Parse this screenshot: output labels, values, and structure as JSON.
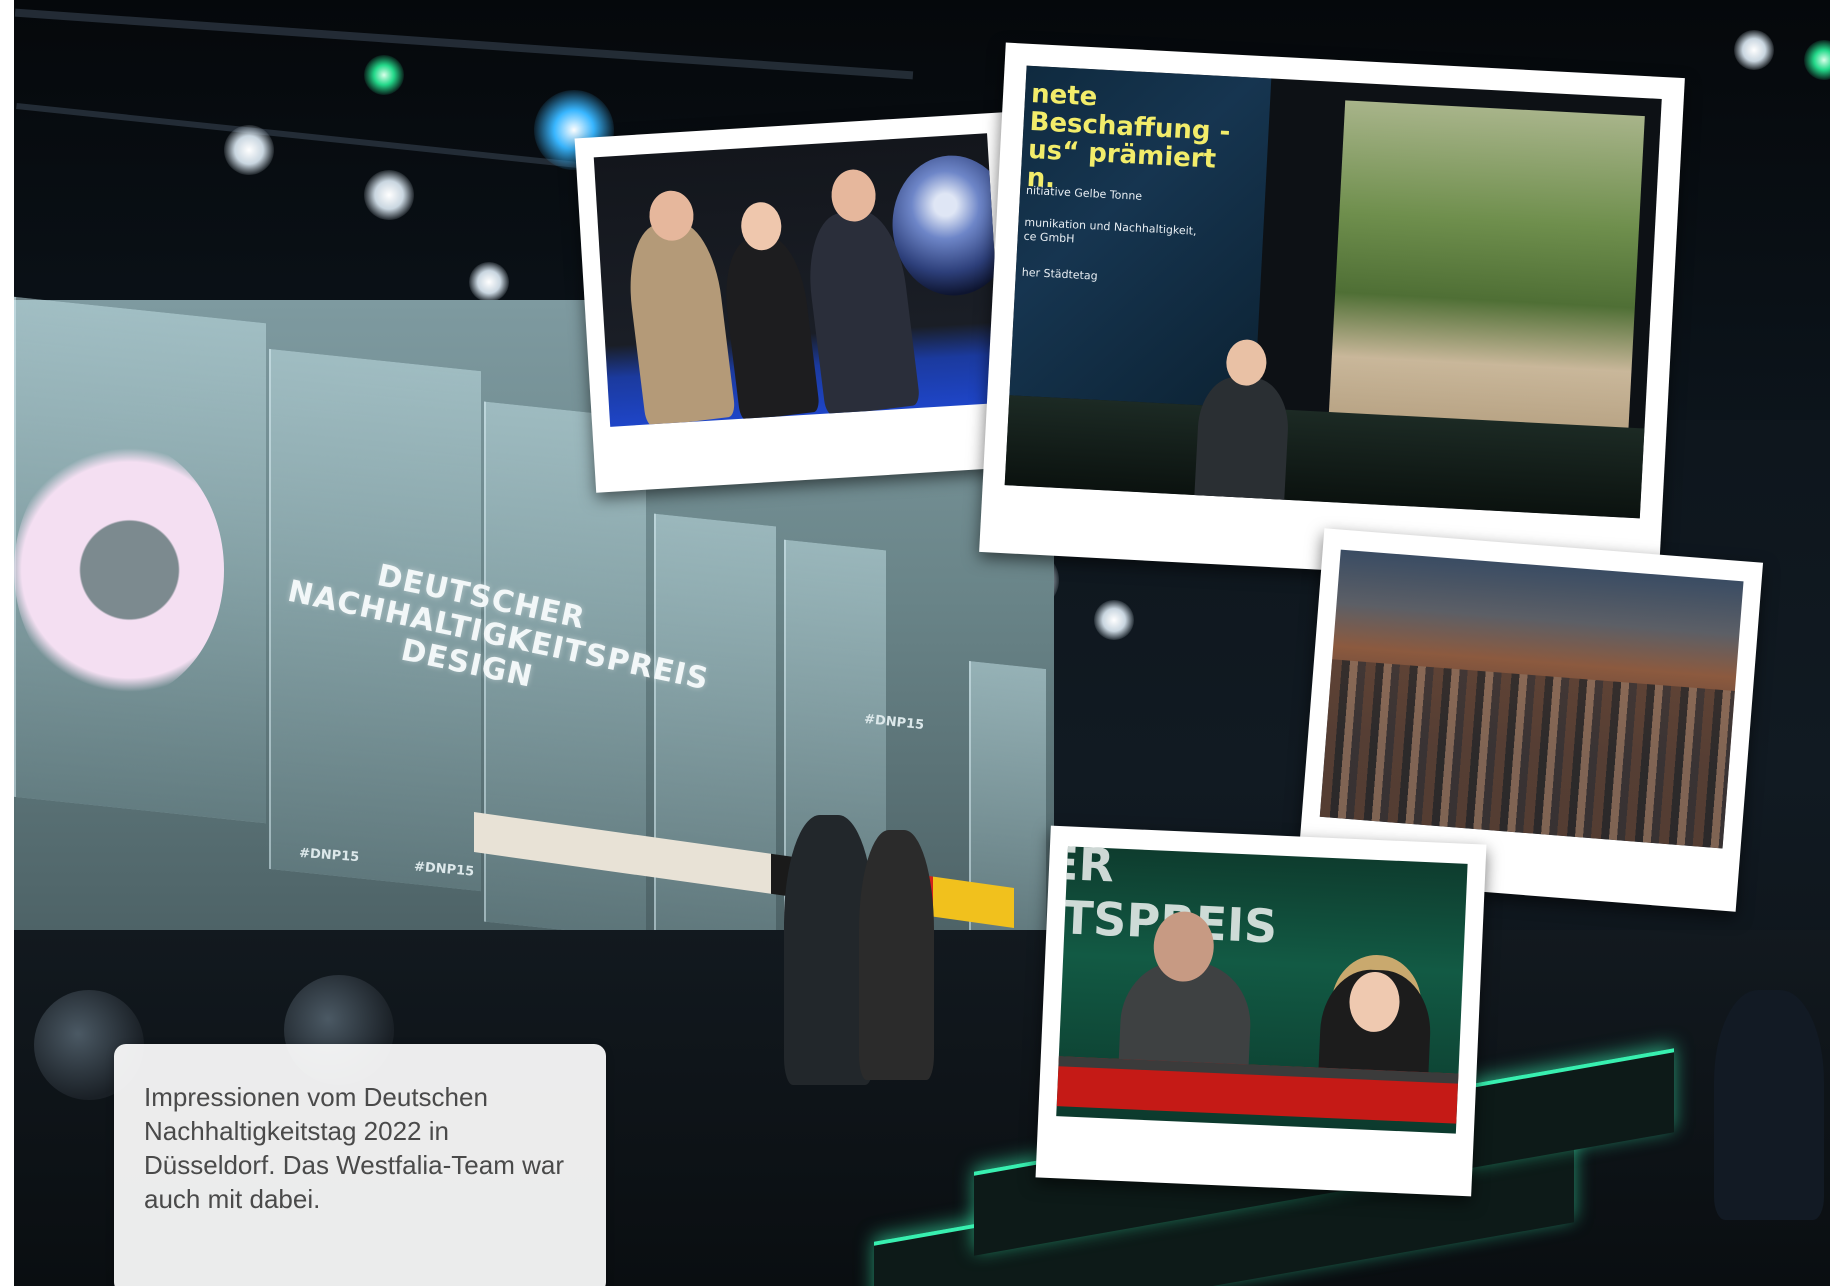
{
  "stage": {
    "title_lines": [
      "DEUTSCHER",
      "NACHHALTIGKEITSPREIS",
      "DESIGN"
    ],
    "hashtag": "#DNP15"
  },
  "photos": {
    "speaker_slide": {
      "headline_lines": [
        "nete Beschaffung -",
        "us“ prämiert",
        "n."
      ],
      "body_lines": [
        "nitiative Gelbe Tonne",
        "munikation und Nachhaltigkeit,",
        "ce GmbH",
        "her Städtetag"
      ]
    },
    "moderator": {
      "backdrop_lines": [
        "ER",
        "ITSPREIS"
      ]
    }
  },
  "caption": {
    "text": "Impressionen vom Deutschen Nachhaltigkeitstag 2022 in Düsseldorf. Das Westfalia-Team war auch mit dabei."
  }
}
